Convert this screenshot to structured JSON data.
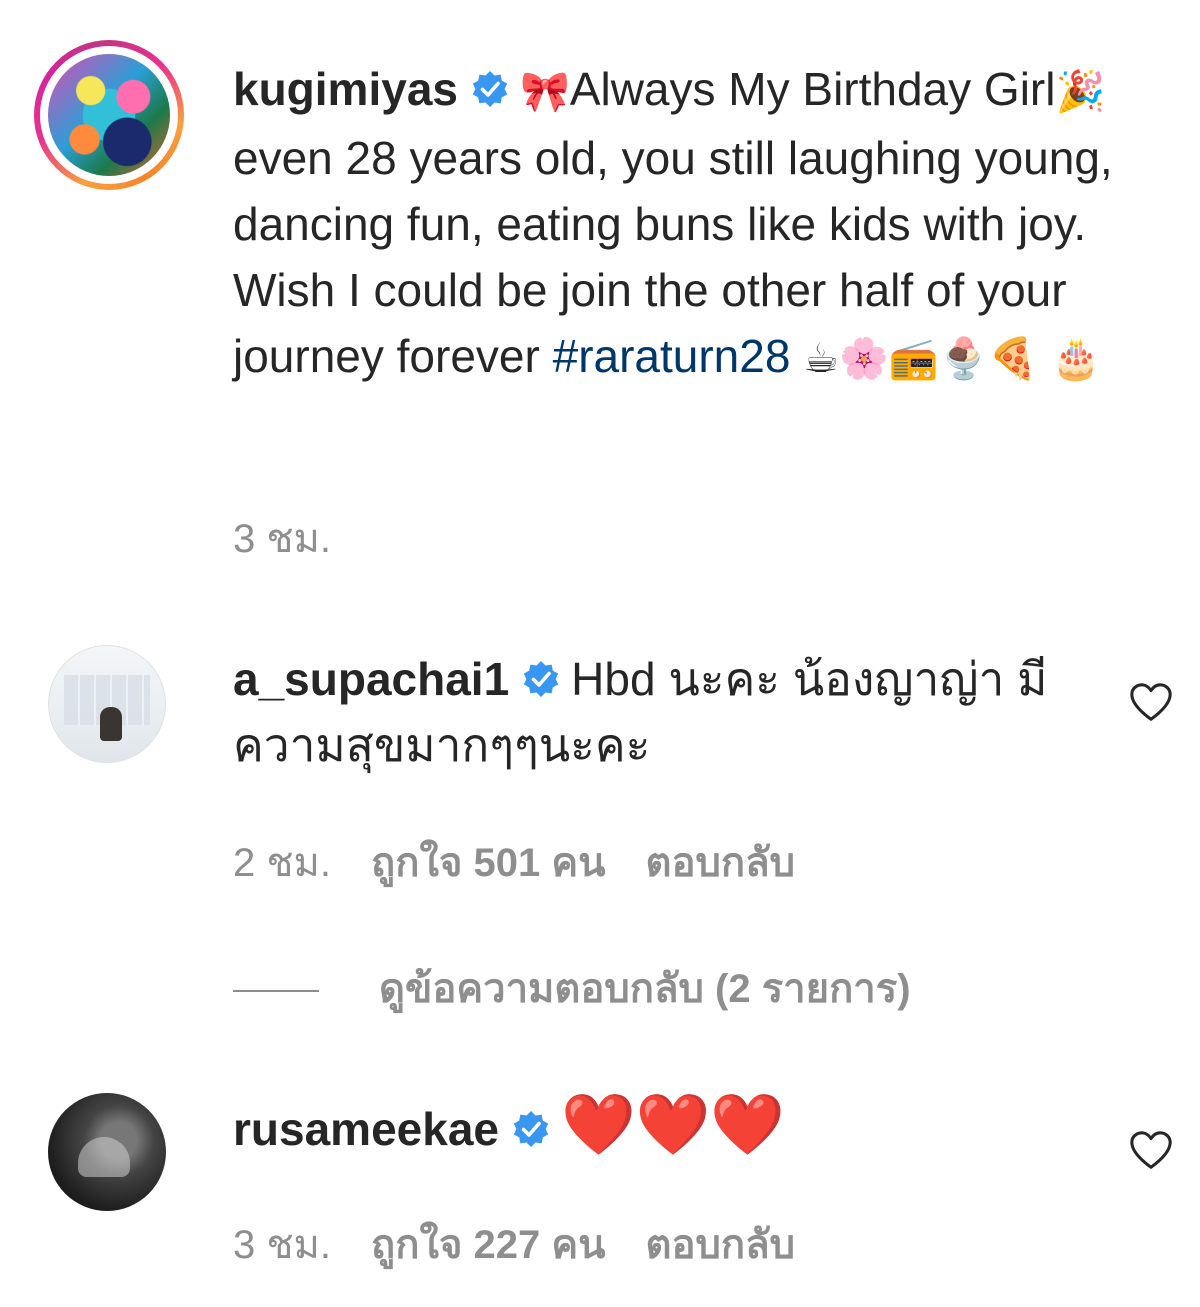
{
  "comments": [
    {
      "username": "kugimiyas",
      "verified": true,
      "text_line1_lead": "🎀",
      "text_part1": "Always My Birthday Girl",
      "text_emoji1": "🎉",
      "text_part2": " even 28 years old, you still laughing young, dancing fun, eating buns like kids with joy. Wish I could be join the other half of your journey forever ",
      "hashtag": "#raraturn28",
      "trailing_emojis": " ☕🌸📻🍨🍕 🎂",
      "time": "3 ชม."
    },
    {
      "username": "a_supachai1",
      "verified": true,
      "text": "Hbd นะคะ น้องญาญ่า มีความสุขมากๆๆนะคะ",
      "time": "2 ชม.",
      "likes": "ถูกใจ 501 คน",
      "reply": "ตอบกลับ",
      "view_replies": "ดูข้อความตอบกลับ (2 รายการ)"
    },
    {
      "username": "rusameekae",
      "verified": true,
      "text": "❤️❤️❤️",
      "time": "3 ชม.",
      "likes": "ถูกใจ 227 คน",
      "reply": "ตอบกลับ"
    }
  ],
  "icons": {
    "verified": "verified-badge-icon",
    "like": "heart-outline-icon"
  },
  "colors": {
    "text": "#262626",
    "muted": "#8e8e8e",
    "hashtag": "#00376b",
    "verified": "#3897f0"
  }
}
